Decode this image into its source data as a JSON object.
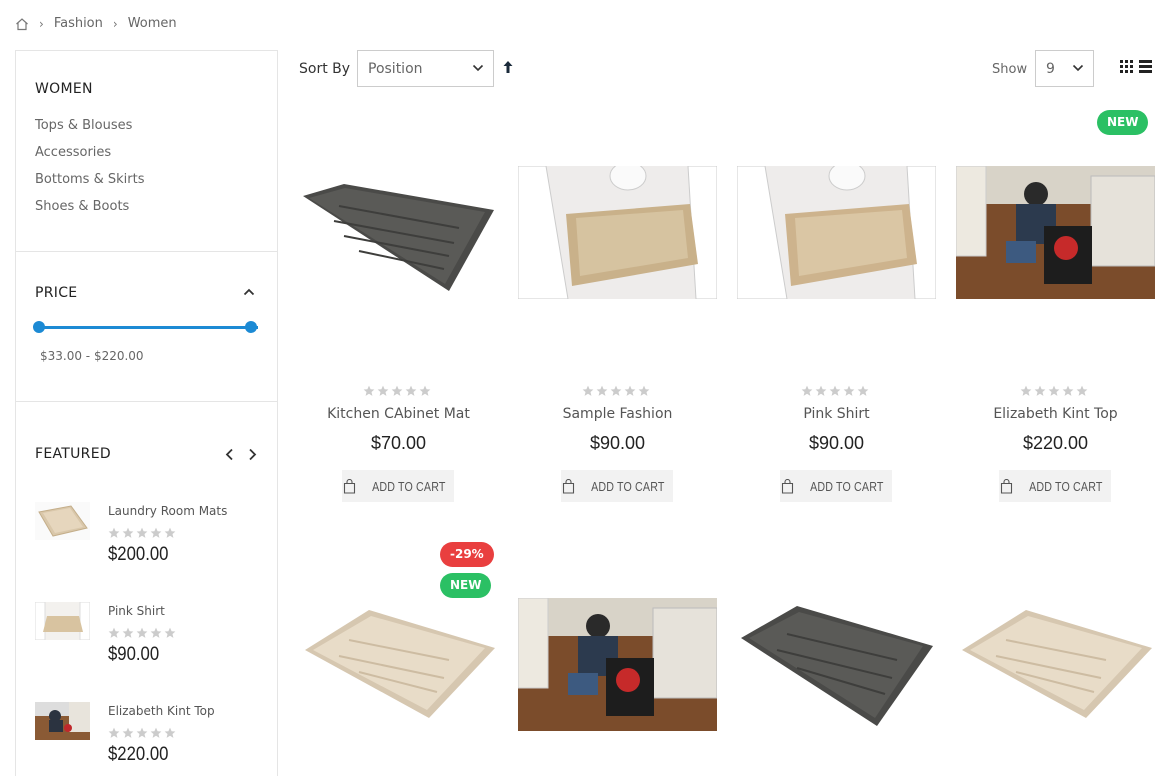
{
  "breadcrumb": {
    "items": [
      "Fashion",
      "Women"
    ]
  },
  "sidebar": {
    "women": {
      "title": "WOMEN",
      "links": [
        "Tops & Blouses",
        "Accessories",
        "Bottoms & Skirts",
        "Shoes & Boots"
      ]
    },
    "price": {
      "title": "PRICE",
      "range_text": "$33.00 - $220.00",
      "slider_min_fraction": 0,
      "slider_max_fraction": 1
    },
    "featured": {
      "title": "FEATURED",
      "items": [
        {
          "name": "Laundry Room Mats",
          "price": "$200.00",
          "rating": 0
        },
        {
          "name": "Pink Shirt",
          "price": "$90.00",
          "rating": 0
        },
        {
          "name": "Elizabeth Kint Top",
          "price": "$220.00",
          "rating": 0
        }
      ]
    }
  },
  "toolbar": {
    "sort_label": "Sort By",
    "sort_value": "Position",
    "show_label": "Show",
    "show_value": "9"
  },
  "products": [
    {
      "name": "Kitchen CAbinet Mat",
      "price": "$70.00",
      "badges": [],
      "cart_label": "ADD TO CART",
      "rating": 0
    },
    {
      "name": "Sample Fashion",
      "price": "$90.00",
      "badges": [],
      "cart_label": "ADD TO CART",
      "rating": 0
    },
    {
      "name": "Pink Shirt",
      "price": "$90.00",
      "badges": [],
      "cart_label": "ADD TO CART",
      "rating": 0
    },
    {
      "name": "Elizabeth Kint Top",
      "price": "$220.00",
      "badges": [
        "NEW"
      ],
      "cart_label": "ADD TO CART",
      "rating": 0
    },
    {
      "name": "",
      "price": "",
      "badges": [
        "-29%",
        "NEW"
      ],
      "cart_label": "",
      "rating": 0
    },
    {
      "name": "",
      "price": "",
      "badges": [],
      "cart_label": "",
      "rating": 0
    },
    {
      "name": "",
      "price": "",
      "badges": [],
      "cart_label": "",
      "rating": 0
    },
    {
      "name": "",
      "price": "",
      "badges": [],
      "cart_label": "",
      "rating": 0
    }
  ],
  "colors": {
    "accent": "#1c8ad4",
    "new_badge": "#2bc064",
    "sale_badge": "#e93f3f",
    "star_empty": "#cccccc"
  }
}
